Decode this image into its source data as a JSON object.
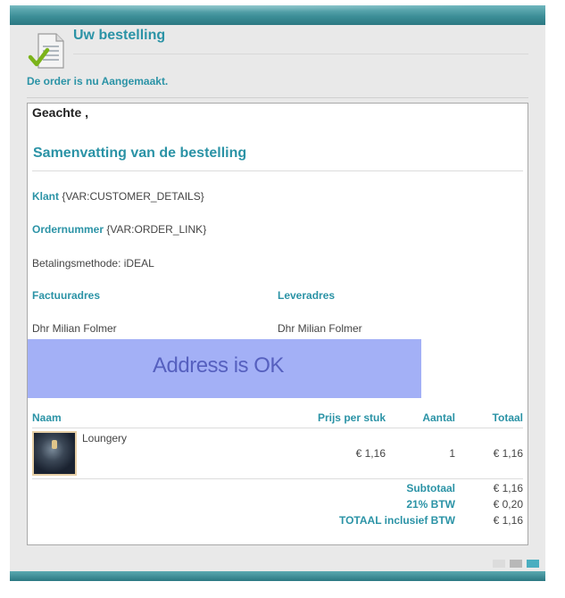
{
  "header": {
    "title": "Uw bestelling",
    "status": "De order is nu Aangemaakt.",
    "icon": "document-check-icon"
  },
  "email": {
    "greeting": "Geachte ,",
    "summary_title": "Samenvatting van de bestelling",
    "customer_label": "Klant",
    "customer_value": "{VAR:CUSTOMER_DETAILS}",
    "order_label": "Ordernummer",
    "order_value": "{VAR:ORDER_LINK}",
    "payment": "Betalingsmethode: iDEAL",
    "billing_label": "Factuuradres",
    "shipping_label": "Leveradres",
    "billing_name": "Dhr Milian Folmer",
    "shipping_name": "Dhr Milian Folmer"
  },
  "overlay": {
    "text": "Address is OK",
    "color": "#a3b0f6"
  },
  "table": {
    "headers": {
      "name": "Naam",
      "price": "Prijs per stuk",
      "qty": "Aantal",
      "total": "Totaal"
    },
    "rows": [
      {
        "name": "Loungery",
        "price": "€ 1,16",
        "qty": "1",
        "total": "€ 1,16"
      }
    ],
    "totals": [
      {
        "label": "Subtotaal",
        "value": "€ 1,16"
      },
      {
        "label": "21% BTW",
        "value": "€ 0,20"
      },
      {
        "label": "TOTAAL inclusief BTW",
        "value": "€ 1,16"
      }
    ]
  },
  "colors": {
    "accent": "#2b93a6",
    "bar": "#2b7882"
  }
}
